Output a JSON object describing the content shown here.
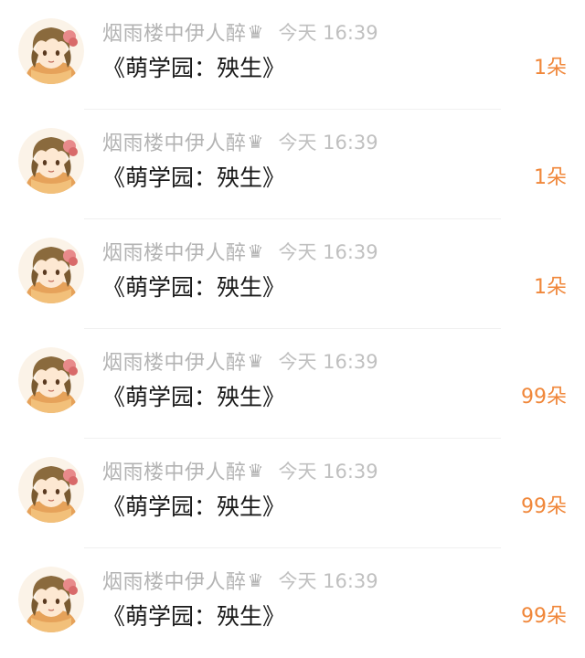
{
  "gifts": [
    {
      "username": "烟雨楼中伊人醉",
      "badge_icon": "crown-icon",
      "time": "今天 16:39",
      "title": "《萌学园：殃生》",
      "count": "1朵"
    },
    {
      "username": "烟雨楼中伊人醉",
      "badge_icon": "crown-icon",
      "time": "今天 16:39",
      "title": "《萌学园：殃生》",
      "count": "1朵"
    },
    {
      "username": "烟雨楼中伊人醉",
      "badge_icon": "crown-icon",
      "time": "今天 16:39",
      "title": "《萌学园：殃生》",
      "count": "1朵"
    },
    {
      "username": "烟雨楼中伊人醉",
      "badge_icon": "crown-icon",
      "time": "今天 16:39",
      "title": "《萌学园：殃生》",
      "count": "99朵"
    },
    {
      "username": "烟雨楼中伊人醉",
      "badge_icon": "crown-icon",
      "time": "今天 16:39",
      "title": "《萌学园：殃生》",
      "count": "99朵"
    },
    {
      "username": "烟雨楼中伊人醉",
      "badge_icon": "crown-icon",
      "time": "今天 16:39",
      "title": "《萌学园：殃生》",
      "count": "99朵"
    }
  ],
  "colors": {
    "count": "#f0873a",
    "username": "#b3b3b3",
    "title": "#1a1a1a"
  }
}
